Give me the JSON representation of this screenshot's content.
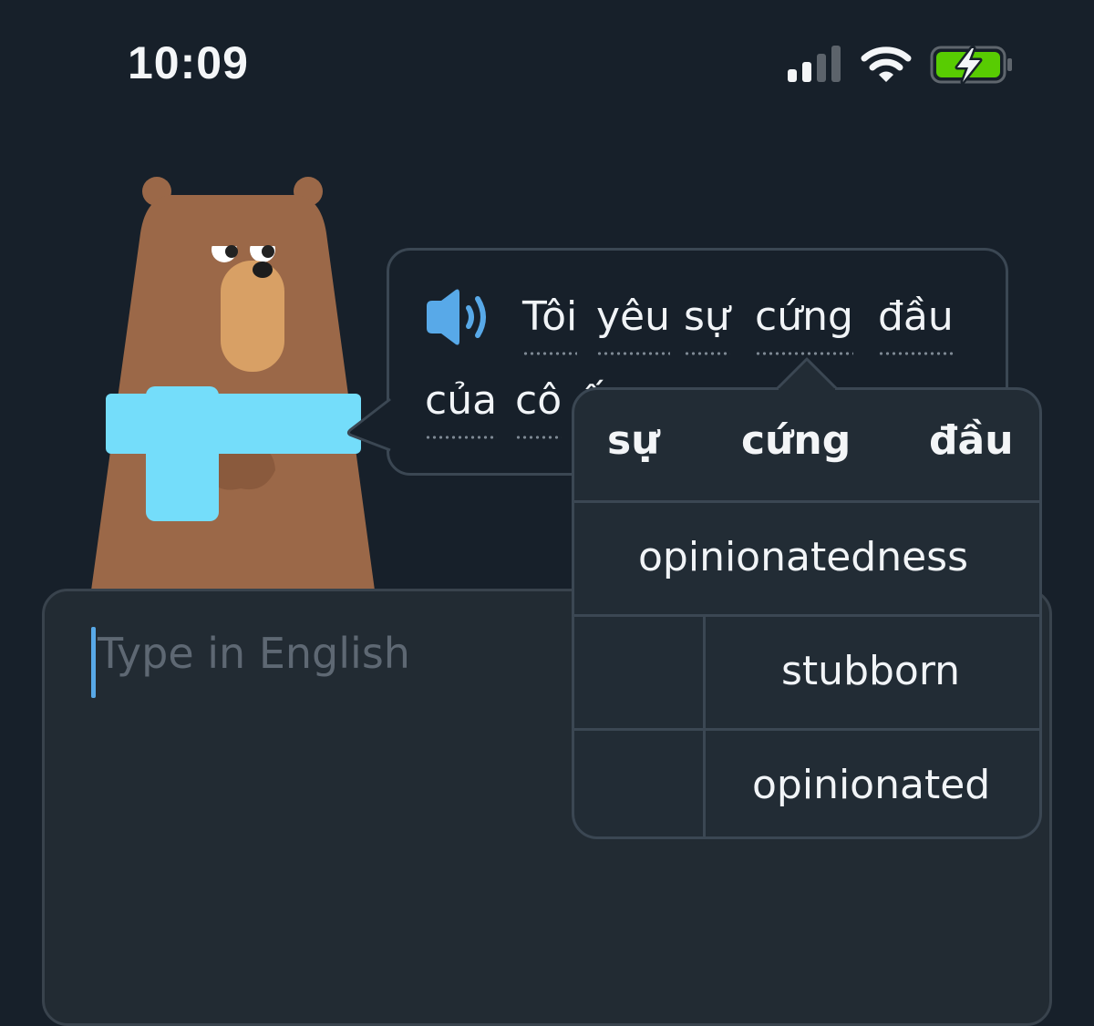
{
  "status_bar": {
    "time": "10:09"
  },
  "prompt": {
    "words": [
      "Tôi",
      "yêu",
      "sự",
      "cứng",
      "đầu",
      "của",
      "cô",
      "ấy"
    ]
  },
  "hint_popup": {
    "header_words": [
      "sự",
      "cứng",
      "đầu"
    ],
    "translations": [
      "opinionatedness",
      "stubborn",
      "opinionated"
    ]
  },
  "answer_input": {
    "placeholder": "Type in English",
    "value": ""
  },
  "colors": {
    "background": "#17202a",
    "panel": "#222c35",
    "border": "#3b4753",
    "accent_blue": "#58a9e8",
    "scarf": "#74ddfa",
    "bear_fur": "#9b6848",
    "battery_green": "#58cc02"
  },
  "icons": [
    "signal-icon",
    "wifi-icon",
    "battery-charging-icon",
    "speaker-icon"
  ]
}
